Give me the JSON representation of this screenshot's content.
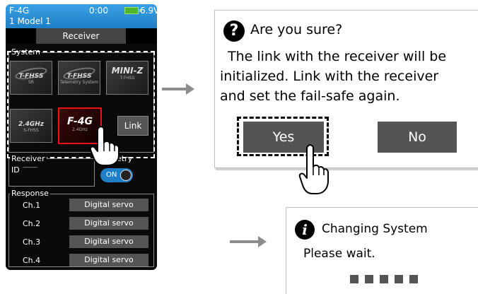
{
  "transmitter": {
    "header": {
      "model_code": "F-4G",
      "timer": "0:00",
      "voltage": "6.9V",
      "model_name": "1   Model 1",
      "battery_color": "#4fb52c"
    },
    "title": "Receiver",
    "system_group": {
      "label": "System",
      "tiles": [
        {
          "logo": "T-FHSS",
          "sub": "SR",
          "icon": "t-fhss-sr-logo"
        },
        {
          "logo": "T-FHSS",
          "sub": "Telemetry System",
          "icon": "t-fhss-telemetry-logo"
        },
        {
          "logo": "MINI-Z",
          "sub": "T-FHSS",
          "icon": "mini-z-logo"
        },
        {
          "logo": "2.4GHz",
          "sub": "S-FHSS",
          "icon": "s-fhss-logo"
        },
        {
          "logo": "F-4G",
          "sub": "2.4GHz",
          "icon": "f-4g-logo",
          "selected": true
        }
      ],
      "link_label": "Link"
    },
    "receiver_group": {
      "label": "Receiver",
      "id_label": "ID",
      "id_value": "---------",
      "telemetry_label": "etry",
      "toggle_label": "ON",
      "toggle_on": true
    },
    "response_group": {
      "label": "Response",
      "channels": [
        {
          "name": "Ch.1",
          "value": "Digital servo"
        },
        {
          "name": "Ch.2",
          "value": "Digital servo"
        },
        {
          "name": "Ch.3",
          "value": "Digital servo"
        },
        {
          "name": "Ch.4",
          "value": "Digital servo"
        }
      ]
    }
  },
  "confirm_dialog": {
    "icon": "question-icon",
    "title": "Are you sure?",
    "message_lines": [
      "The link with the receiver will be",
      "initialized. Link with the receiver",
      "and set the fail-safe again."
    ],
    "yes_label": "Yes",
    "no_label": "No"
  },
  "progress_dialog": {
    "icon": "info-icon",
    "title": "Changing System",
    "message": "Please wait.",
    "progress_steps": 5
  },
  "colors": {
    "header_blue": "#1f7fc6",
    "button_gray": "#545454",
    "selected_red": "#e11111",
    "arrow_gray": "#8d8d8d"
  }
}
